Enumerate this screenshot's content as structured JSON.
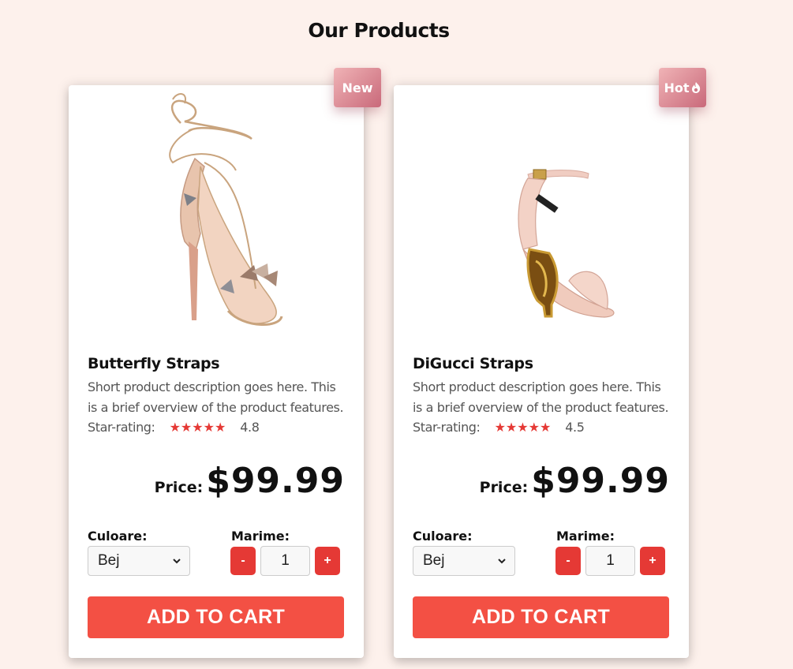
{
  "page": {
    "title": "Our Products"
  },
  "products": [
    {
      "name": "Butterfly Straps",
      "badge": "New",
      "badge_icon": "",
      "description": "Short product description goes here. This is a brief overview of the product features.",
      "rating_label": "Star-rating:",
      "stars": "★★★★★",
      "rating": "4.8",
      "price_label": "Price:",
      "price": "$99.99",
      "color_label": "Culoare:",
      "color_value": "Bej",
      "size_label": "Marime:",
      "minus_label": "-",
      "plus_label": "+",
      "quantity": "1",
      "cart_label": "ADD TO CART",
      "image_icon": "strappy-heel-butterfly-image"
    },
    {
      "name": "DiGucci Straps",
      "badge": "Hot",
      "badge_icon": "fire-icon",
      "description": "Short product description goes here. This is a brief overview of the product features.",
      "rating_label": "Star-rating:",
      "stars": "★★★★★",
      "rating": "4.5",
      "price_label": "Price:",
      "price": "$99.99",
      "color_label": "Culoare:",
      "color_value": "Bej",
      "size_label": "Marime:",
      "minus_label": "-",
      "plus_label": "+",
      "quantity": "1",
      "cart_label": "ADD TO CART",
      "image_icon": "sculpted-heel-sandal-image"
    }
  ],
  "colors": {
    "background": "#fdf1ec",
    "accent": "#e53935",
    "cart_button": "#f35044",
    "badge_gradient_start": "#f0b3b6",
    "badge_gradient_end": "#c9697a"
  }
}
